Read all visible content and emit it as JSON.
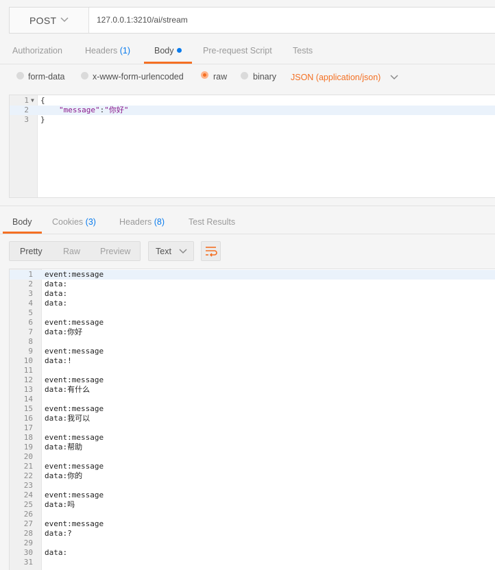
{
  "request": {
    "method": "POST",
    "url": "127.0.0.1:3210/ai/stream"
  },
  "request_tabs": {
    "authorization": "Authorization",
    "headers": "Headers",
    "headers_count": "(1)",
    "body": "Body",
    "pre_request": "Pre-request Script",
    "tests": "Tests"
  },
  "body_types": {
    "form_data": "form-data",
    "urlencoded": "x-www-form-urlencoded",
    "raw": "raw",
    "binary": "binary",
    "selected_format": "JSON (application/json)"
  },
  "request_body": {
    "lines": [
      {
        "n": "1",
        "text": "{"
      },
      {
        "n": "2",
        "key": "\"message\"",
        "sep": ":",
        "value": "\"你好\""
      },
      {
        "n": "3",
        "text": "}"
      }
    ]
  },
  "response_tabs": {
    "body": "Body",
    "cookies": "Cookies",
    "cookies_count": "(3)",
    "headers": "Headers",
    "headers_count": "(8)",
    "test_results": "Test Results"
  },
  "response_toolbar": {
    "pretty": "Pretty",
    "raw": "Raw",
    "preview": "Preview",
    "format": "Text"
  },
  "response_body": {
    "lines": [
      "event:message",
      "data:",
      "data:",
      "data:",
      "",
      "event:message",
      "data:你好",
      "",
      "event:message",
      "data:!",
      "",
      "event:message",
      "data:有什么",
      "",
      "event:message",
      "data:我可以",
      "",
      "event:message",
      "data:帮助",
      "",
      "event:message",
      "data:你的",
      "",
      "event:message",
      "data:吗",
      "",
      "event:message",
      "data:?",
      "",
      "data:",
      ""
    ]
  },
  "colors": {
    "accent": "#f47023",
    "count_blue": "#097bed",
    "json_key": "#8b1b8e"
  }
}
